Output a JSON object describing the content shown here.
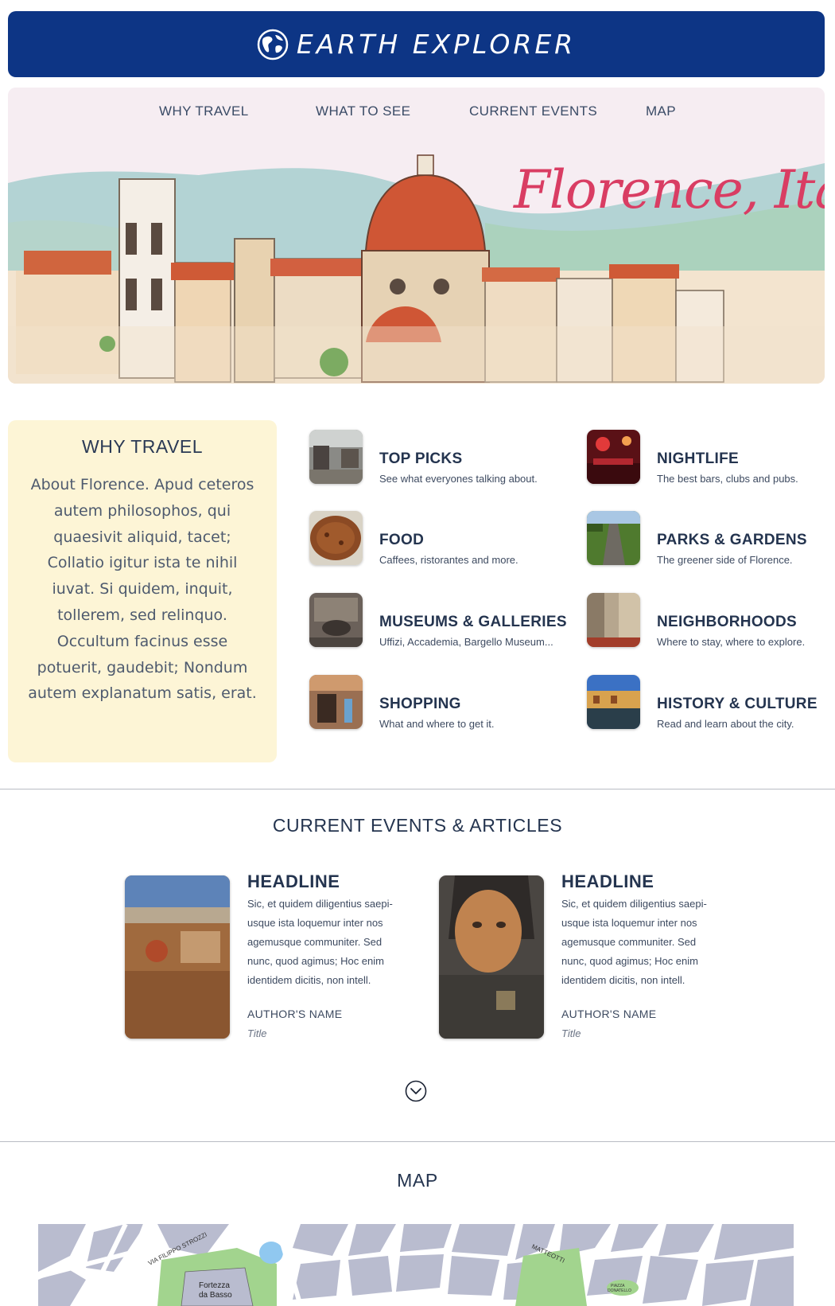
{
  "header": {
    "brand": "EARTH EXPLORER",
    "logo_icon": "globe-icon",
    "background": "#0d3585"
  },
  "nav": {
    "items": [
      {
        "label": "WHY TRAVEL"
      },
      {
        "label": "WHAT TO SEE"
      },
      {
        "label": "CURRENT EVENTS"
      },
      {
        "label": "MAP"
      }
    ]
  },
  "hero": {
    "title": "Florence, Italy",
    "title_color": "#d93d63"
  },
  "why_travel": {
    "heading": "WHY TRAVEL",
    "body": "About Florence. Apud ceteros autem philosophos, qui quaesivit aliquid, tacet; Collatio igitur ista te nihil iuvat. Si quidem, inquit, tollerem, sed relinquo. Occultum facinus esse potuerit, gaudebit; Nondum autem explanatum satis, erat."
  },
  "categories": [
    {
      "title": "TOP PICKS",
      "desc": "See what everyones talking about."
    },
    {
      "title": "NIGHTLIFE",
      "desc": "The best bars, clubs and pubs."
    },
    {
      "title": "FOOD",
      "desc": "Caffees, ristorantes and more."
    },
    {
      "title": "PARKS & GARDENS",
      "desc": "The greener side of Florence."
    },
    {
      "title": "MUSEUMS & GALLERIES",
      "desc": "Uffizi, Accademia, Bargello Museum..."
    },
    {
      "title": "NEIGHBORHOODS",
      "desc": "Where to stay, where to explore."
    },
    {
      "title": "SHOPPING",
      "desc": "What and where to get it."
    },
    {
      "title": "HISTORY & CULTURE",
      "desc": "Read and learn about the city."
    }
  ],
  "events": {
    "heading": "CURRENT EVENTS & ARTICLES",
    "articles": [
      {
        "headline": "HEADLINE",
        "body": "Sic, et quidem diligentius saepi-usque ista loquemur inter nos agemusque communiter. Sed nunc, quod agimus; Hoc enim identidem dicitis, non intell.",
        "author": "AUTHOR'S NAME",
        "title": "Title"
      },
      {
        "headline": "HEADLINE",
        "body": "Sic, et quidem diligentius saepi-usque ista loquemur inter nos agemusque communiter. Sed nunc, quod agimus; Hoc enim identidem dicitis, non intell.",
        "author": "AUTHOR'S NAME",
        "title": "Title"
      }
    ],
    "more_icon": "chevron-down-circle-icon"
  },
  "map": {
    "heading": "MAP",
    "labels": {
      "fortezza": "Fortezza",
      "da_basso": "da Basso",
      "viale_filippo": "VIA FILIPPO STROZZI",
      "matteotti": "MATTEOTTI",
      "piazza": "PIAZZA",
      "donatello": "DONATELLO"
    }
  }
}
